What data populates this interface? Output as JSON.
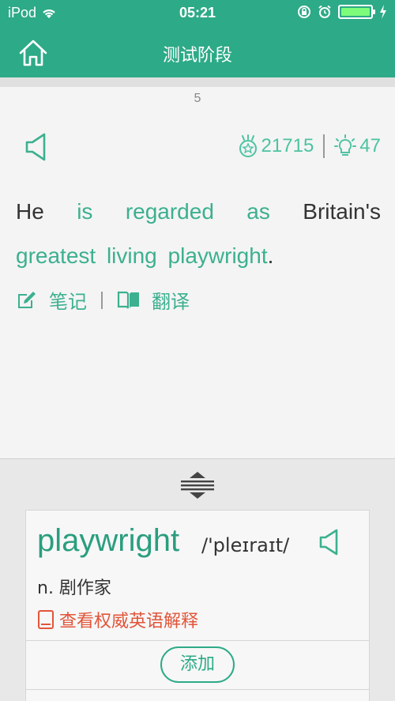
{
  "status_bar": {
    "carrier": "iPod",
    "time": "05:21"
  },
  "nav": {
    "title": "测试阶段"
  },
  "progress": {
    "page_number": "5"
  },
  "stats": {
    "score": "21715",
    "hints": "47"
  },
  "sentence": {
    "line1": [
      {
        "text": "He",
        "highlight": false
      },
      {
        "text": "is",
        "highlight": true
      },
      {
        "text": "regarded",
        "highlight": true
      },
      {
        "text": "as",
        "highlight": true
      },
      {
        "text": "Britain's",
        "highlight": false
      }
    ],
    "line2": [
      {
        "text": "greatest living playwright",
        "highlight": true
      },
      {
        "text": ".",
        "highlight": false
      }
    ]
  },
  "actions": {
    "notes_label": "笔记",
    "translate_label": "翻译"
  },
  "word_card": {
    "word": "playwright",
    "phonetic": "/'pleɪraɪt/",
    "definition": "n. 剧作家",
    "authority_link": "查看权威英语解释",
    "add_label": "添加"
  },
  "colors": {
    "brand": "#2daa87",
    "highlight": "#3cb08f",
    "link": "#e2553a"
  }
}
